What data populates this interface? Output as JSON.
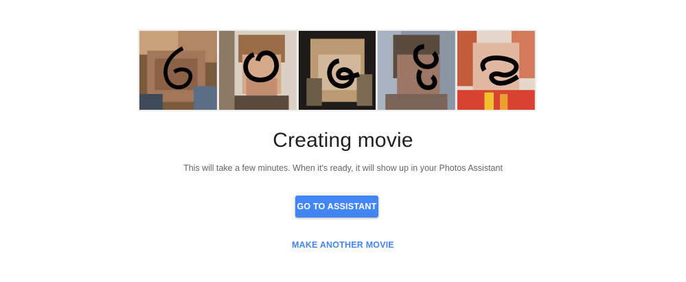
{
  "thumbnails": [
    {
      "name": "photo-1"
    },
    {
      "name": "photo-2"
    },
    {
      "name": "photo-3"
    },
    {
      "name": "photo-4"
    },
    {
      "name": "photo-5"
    }
  ],
  "main": {
    "title": "Creating movie",
    "subtitle": "This will take a few minutes. When it's ready, it will show up in your Photos Assistant",
    "primary_button_label": "GO TO ASSISTANT",
    "secondary_button_label": "MAKE ANOTHER MOVIE"
  },
  "colors": {
    "accent": "#4285f4",
    "title_text": "#202124",
    "body_text": "#666666",
    "background": "#ffffff"
  }
}
